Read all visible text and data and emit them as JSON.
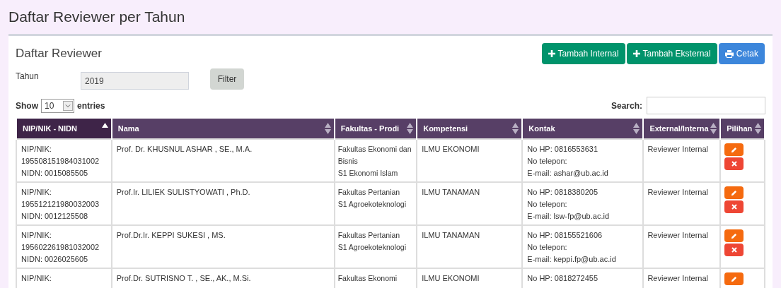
{
  "page_title": "Daftar Reviewer per Tahun",
  "panel_title": "Daftar Reviewer",
  "actions": [
    {
      "kind": "add",
      "label": "Tambah Internal"
    },
    {
      "kind": "add",
      "label": "Tambah Eksternal"
    },
    {
      "kind": "print",
      "label": "Cetak"
    }
  ],
  "filter": {
    "label": "Tahun",
    "value": "2019",
    "button": "Filter"
  },
  "length": {
    "prefix": "Show",
    "value": "10",
    "suffix": "entries"
  },
  "search": {
    "label": "Search:"
  },
  "table": {
    "columns": [
      {
        "label": "NIP/NIK - NIDN",
        "kind": "sorted_ascending"
      },
      {
        "label": "Nama",
        "kind": "sortable"
      },
      {
        "label": "Fakultas - Prodi",
        "kind": "sortable"
      },
      {
        "label": "Kompetensi",
        "kind": "sortable"
      },
      {
        "label": "Kontak",
        "kind": "sortable"
      },
      {
        "label": "External/Interna",
        "kind": "sortable"
      },
      {
        "label": "Pilihan",
        "kind": "sortable"
      }
    ],
    "rows": [
      {
        "nip": [
          "NIP/NIK:",
          "195508151984031002",
          "NIDN: 0015085505"
        ],
        "nama": "Prof. Dr. KHUSNUL ASHAR , SE., M.A.",
        "fakultas": [
          "Fakultas Ekonomi dan Bisnis",
          "S1 Ekonomi Islam"
        ],
        "kompetensi": "ILMU EKONOMI",
        "kontak": [
          "No HP: 0816553631",
          "No telepon:",
          "E-mail: ashar@ub.ac.id"
        ],
        "jenis": "Reviewer Internal",
        "actions": [
          {
            "kind": "edit"
          },
          {
            "kind": "delete"
          }
        ]
      },
      {
        "nip": [
          "NIP/NIK:",
          "195512121980032003",
          "NIDN: 0012125508"
        ],
        "nama": "Prof.Ir. LILIEK SULISTYOWATI , Ph.D.",
        "fakultas": [
          "Fakultas Pertanian",
          "S1 Agroekoteknologi"
        ],
        "kompetensi": "ILMU TANAMAN",
        "kontak": [
          "No HP: 0818380205",
          "No telepon:",
          "E-mail: lsw-fp@ub.ac.id"
        ],
        "jenis": "Reviewer Internal",
        "actions": [
          {
            "kind": "edit"
          },
          {
            "kind": "delete"
          }
        ]
      },
      {
        "nip": [
          "NIP/NIK:",
          "195602261981032002",
          "NIDN: 0026025605"
        ],
        "nama": "Prof.Dr.Ir. KEPPI SUKESI , MS.",
        "fakultas": [
          "Fakultas Pertanian",
          "S1 Agroekoteknologi"
        ],
        "kompetensi": "ILMU TANAMAN",
        "kontak": [
          "No HP: 08155521606",
          "No telepon:",
          "E-mail: keppi.fp@ub.ac.id"
        ],
        "jenis": "Reviewer Internal",
        "actions": [
          {
            "kind": "edit"
          },
          {
            "kind": "delete"
          }
        ]
      },
      {
        "nip": [
          "NIP/NIK:"
        ],
        "nama": "Prof.Dr. SUTRISNO T. , SE., AK., M.Si.",
        "fakultas": [
          "Fakultas Ekonomi"
        ],
        "kompetensi": "ILMU EKONOMI",
        "kontak": [
          "No HP: 0818272455"
        ],
        "jenis": "Reviewer Internal",
        "actions": [
          {
            "kind": "edit"
          }
        ]
      }
    ]
  }
}
